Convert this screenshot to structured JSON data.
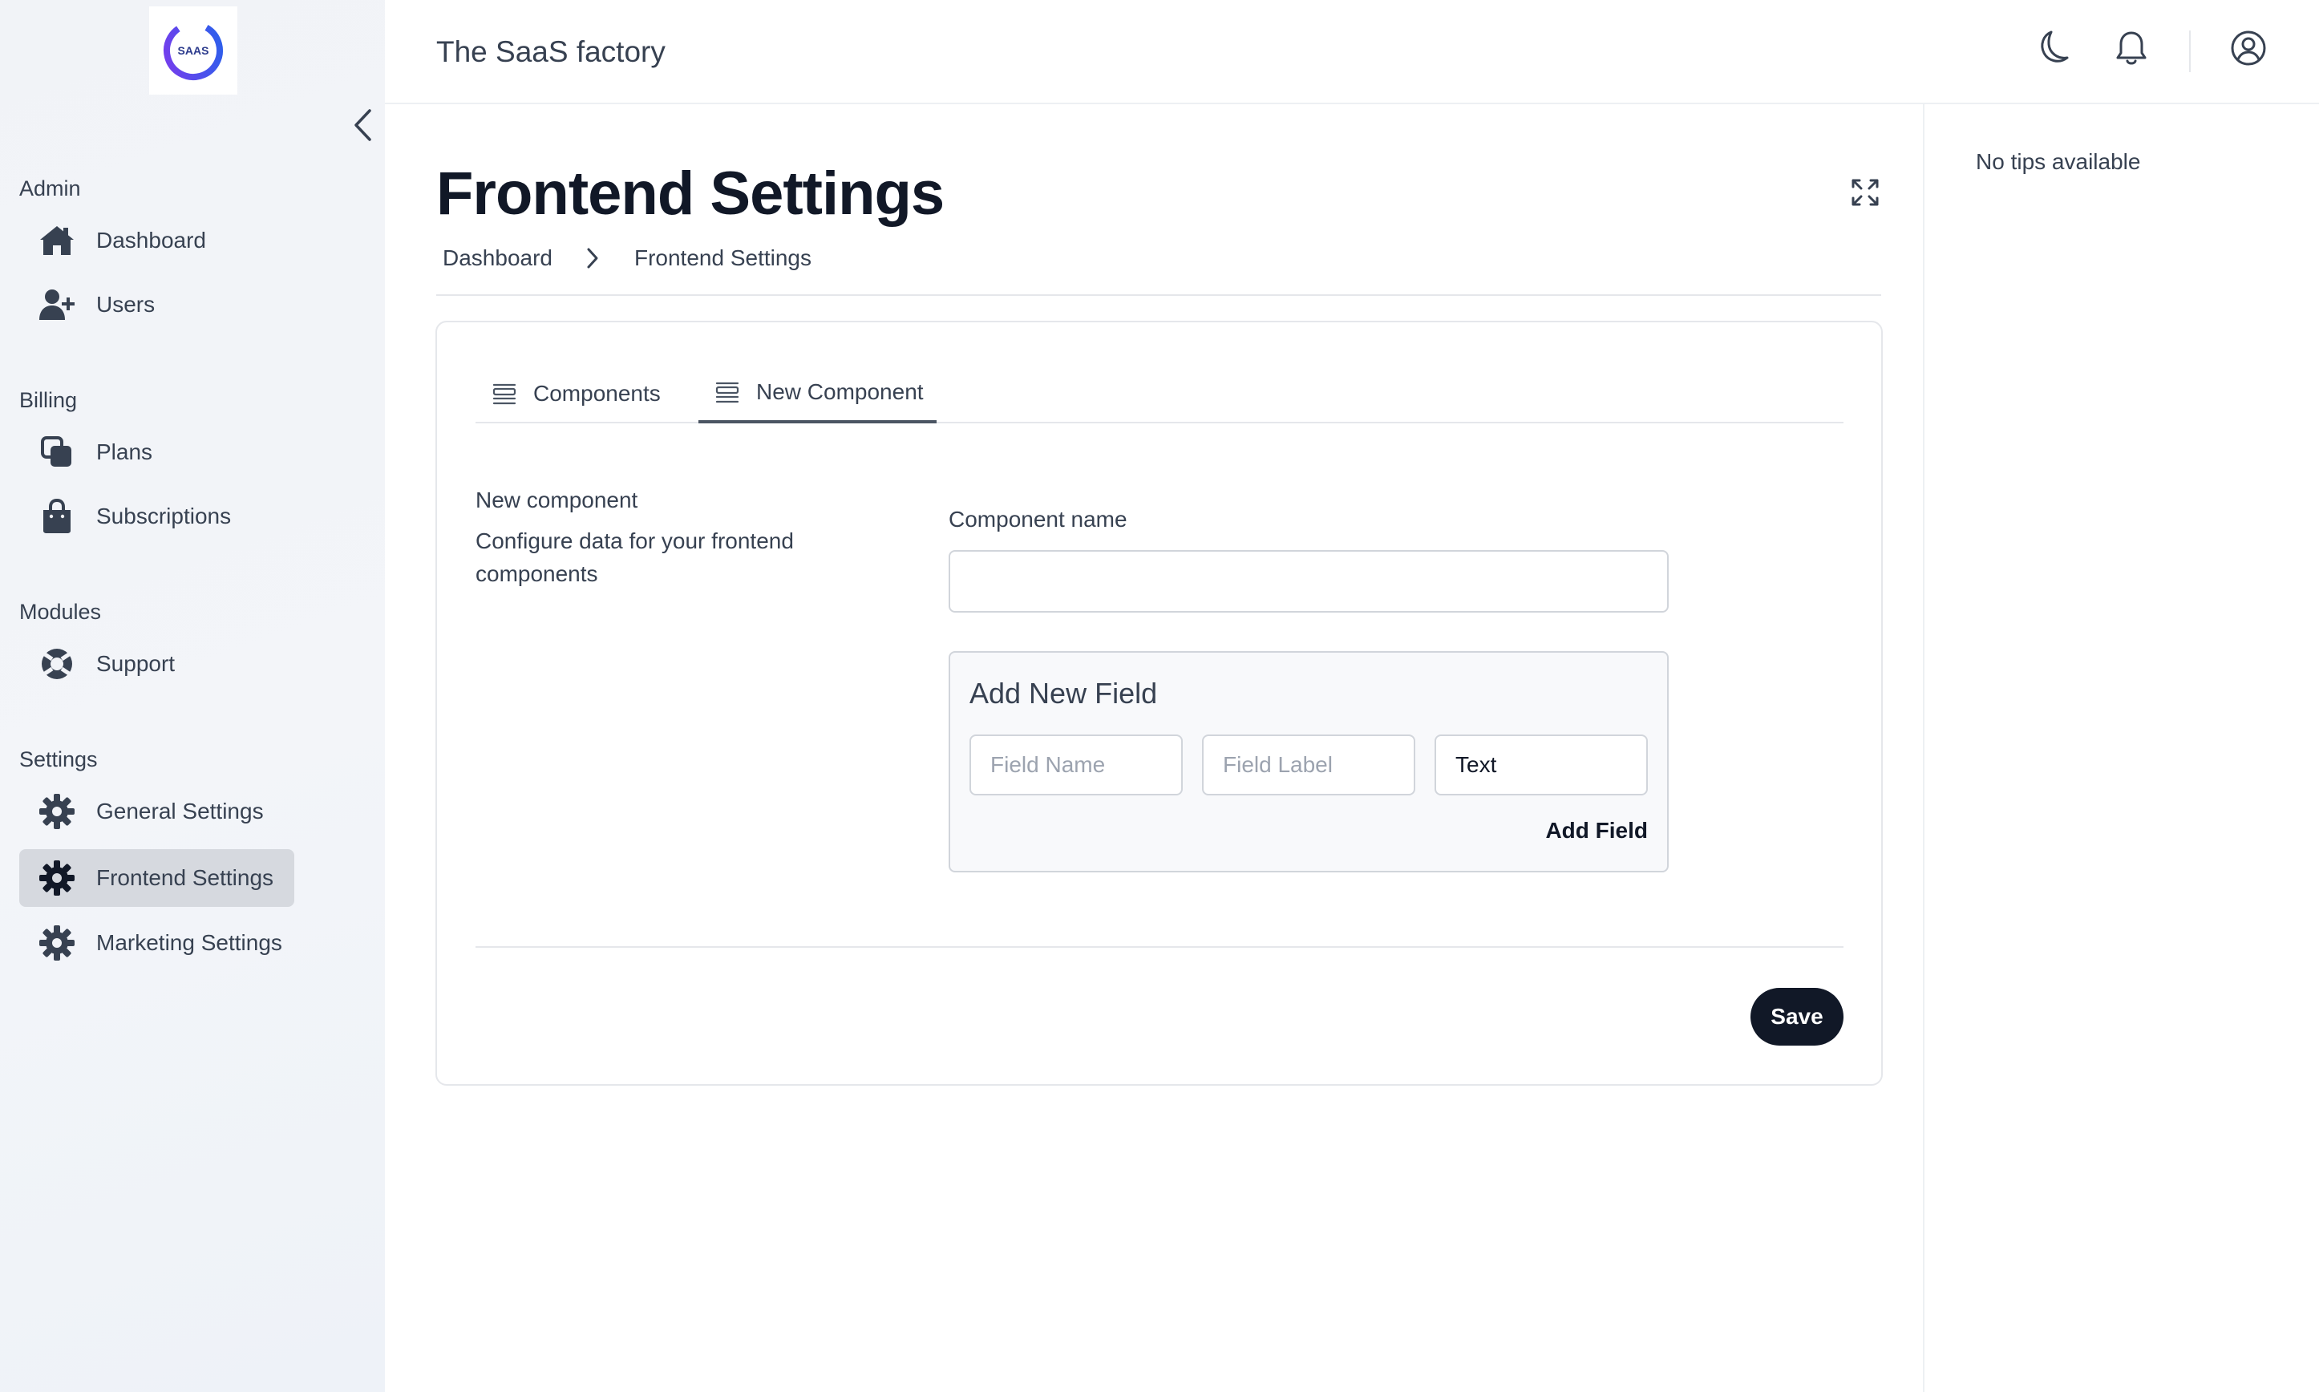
{
  "app": {
    "title": "The SaaS factory",
    "logo_text": "SAAS"
  },
  "colors": {
    "primary": "#111827",
    "sidebar_bg": "#f1f3f7",
    "active_item_bg": "#d6d9df",
    "logo_ring_start": "#7c3aed",
    "logo_ring_end": "#2563eb"
  },
  "sidebar": {
    "sections": [
      {
        "title": "Admin",
        "items": [
          {
            "label": "Dashboard",
            "icon": "house-icon"
          },
          {
            "label": "Users",
            "icon": "user-plus-icon"
          }
        ]
      },
      {
        "title": "Billing",
        "items": [
          {
            "label": "Plans",
            "icon": "stacked-squares-icon"
          },
          {
            "label": "Subscriptions",
            "icon": "shopping-bag-icon"
          }
        ]
      },
      {
        "title": "Modules",
        "items": [
          {
            "label": "Support",
            "icon": "life-ring-icon"
          }
        ]
      },
      {
        "title": "Settings",
        "items": [
          {
            "label": "General Settings",
            "icon": "gear-icon"
          },
          {
            "label": "Frontend Settings",
            "icon": "gear-icon",
            "active": true
          },
          {
            "label": "Marketing Settings",
            "icon": "gear-icon"
          }
        ]
      }
    ]
  },
  "topbar": {
    "icons": [
      "moon-icon",
      "bell-icon",
      "user-circle-icon"
    ]
  },
  "tips": {
    "text": "No tips available"
  },
  "page": {
    "title": "Frontend Settings",
    "breadcrumb": [
      "Dashboard",
      "Frontend Settings"
    ]
  },
  "tabs": [
    {
      "label": "Components",
      "icon": "list-icon",
      "active": false
    },
    {
      "label": "New Component",
      "icon": "list-icon",
      "active": true
    }
  ],
  "form": {
    "section_title": "New component",
    "section_description": "Configure data for your frontend components",
    "component_name_label": "Component name",
    "component_name_value": "",
    "add_field": {
      "title": "Add New Field",
      "field_name_placeholder": "Field Name",
      "field_label_placeholder": "Field Label",
      "type_value": "Text",
      "button_label": "Add Field"
    },
    "save_label": "Save"
  }
}
